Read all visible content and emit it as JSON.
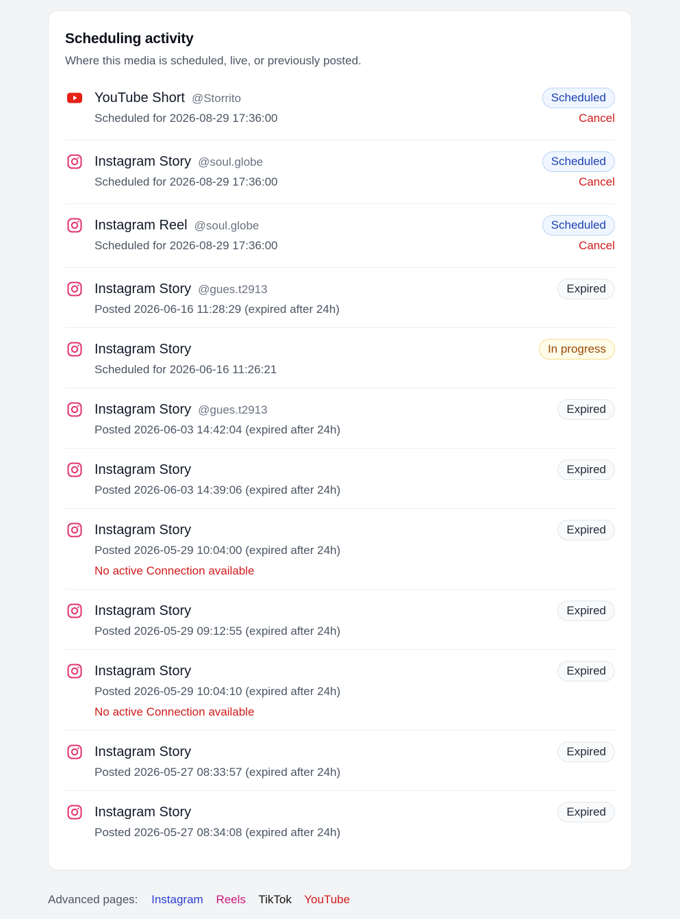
{
  "card": {
    "title": "Scheduling activity",
    "subtitle": "Where this media is scheduled, live, or previously posted."
  },
  "colors": {
    "instagram_icon": "#e1306c",
    "youtube_icon": "#e62117",
    "scheduled_badge_text": "#1e40af",
    "cancel_text": "#d11a1a",
    "progress_badge_text": "#9a4a09"
  },
  "activity": [
    {
      "icon": "youtube-icon",
      "platform": "YouTube Short",
      "handle": "@Storrito",
      "detail": "Scheduled for 2026-08-29 17:36:00",
      "status": "Scheduled",
      "status_type": "scheduled",
      "action": "Cancel",
      "error": ""
    },
    {
      "icon": "instagram-icon",
      "platform": "Instagram Story",
      "handle": "@soul.globe",
      "detail": "Scheduled for 2026-08-29 17:36:00",
      "status": "Scheduled",
      "status_type": "scheduled",
      "action": "Cancel",
      "error": ""
    },
    {
      "icon": "instagram-icon",
      "platform": "Instagram Reel",
      "handle": "@soul.globe",
      "detail": "Scheduled for 2026-08-29 17:36:00",
      "status": "Scheduled",
      "status_type": "scheduled",
      "action": "Cancel",
      "error": ""
    },
    {
      "icon": "instagram-icon",
      "platform": "Instagram Story",
      "handle": "@gues.t2913",
      "detail": "Posted 2026-06-16 11:28:29 (expired after 24h)",
      "status": "Expired",
      "status_type": "expired",
      "action": "",
      "error": ""
    },
    {
      "icon": "instagram-icon",
      "platform": "Instagram Story",
      "handle": "",
      "detail": "Scheduled for 2026-06-16 11:26:21",
      "status": "In progress",
      "status_type": "progress",
      "action": "",
      "error": ""
    },
    {
      "icon": "instagram-icon",
      "platform": "Instagram Story",
      "handle": "@gues.t2913",
      "detail": "Posted 2026-06-03 14:42:04 (expired after 24h)",
      "status": "Expired",
      "status_type": "expired",
      "action": "",
      "error": ""
    },
    {
      "icon": "instagram-icon",
      "platform": "Instagram Story",
      "handle": "",
      "detail": "Posted 2026-06-03 14:39:06 (expired after 24h)",
      "status": "Expired",
      "status_type": "expired",
      "action": "",
      "error": ""
    },
    {
      "icon": "instagram-icon",
      "platform": "Instagram Story",
      "handle": "",
      "detail": "Posted 2026-05-29 10:04:00 (expired after 24h)",
      "status": "Expired",
      "status_type": "expired",
      "action": "",
      "error": "No active Connection available"
    },
    {
      "icon": "instagram-icon",
      "platform": "Instagram Story",
      "handle": "",
      "detail": "Posted 2026-05-29 09:12:55 (expired after 24h)",
      "status": "Expired",
      "status_type": "expired",
      "action": "",
      "error": ""
    },
    {
      "icon": "instagram-icon",
      "platform": "Instagram Story",
      "handle": "",
      "detail": "Posted 2026-05-29 10:04:10 (expired after 24h)",
      "status": "Expired",
      "status_type": "expired",
      "action": "",
      "error": "No active Connection available"
    },
    {
      "icon": "instagram-icon",
      "platform": "Instagram Story",
      "handle": "",
      "detail": "Posted 2026-05-27 08:33:57 (expired after 24h)",
      "status": "Expired",
      "status_type": "expired",
      "action": "",
      "error": ""
    },
    {
      "icon": "instagram-icon",
      "platform": "Instagram Story",
      "handle": "",
      "detail": "Posted 2026-05-27 08:34:08 (expired after 24h)",
      "status": "Expired",
      "status_type": "expired",
      "action": "",
      "error": ""
    }
  ],
  "footer": {
    "label": "Advanced pages:",
    "links": [
      "Instagram",
      "Reels",
      "TikTok",
      "YouTube"
    ]
  }
}
